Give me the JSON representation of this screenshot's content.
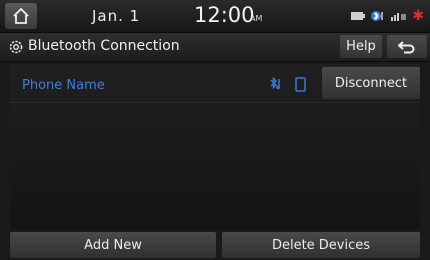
{
  "status": {
    "date": "Jan.  1",
    "time": "12:00",
    "ampm": "AM",
    "icons": [
      "battery-icon",
      "bluetooth-audio-icon",
      "signal-icon",
      "alert-icon"
    ]
  },
  "header": {
    "title": "Bluetooth Connection",
    "help_label": "Help"
  },
  "devices": [
    {
      "name": "Phone Name",
      "icons": [
        "bluetooth-audio-icon",
        "phone-icon"
      ],
      "action_label": "Disconnect"
    }
  ],
  "footer": {
    "add_label": "Add New",
    "delete_label": "Delete Devices"
  },
  "colors": {
    "device_name": "#3f7fd6",
    "alert": "#e32b2b",
    "accent_blue": "#3a78d4"
  }
}
